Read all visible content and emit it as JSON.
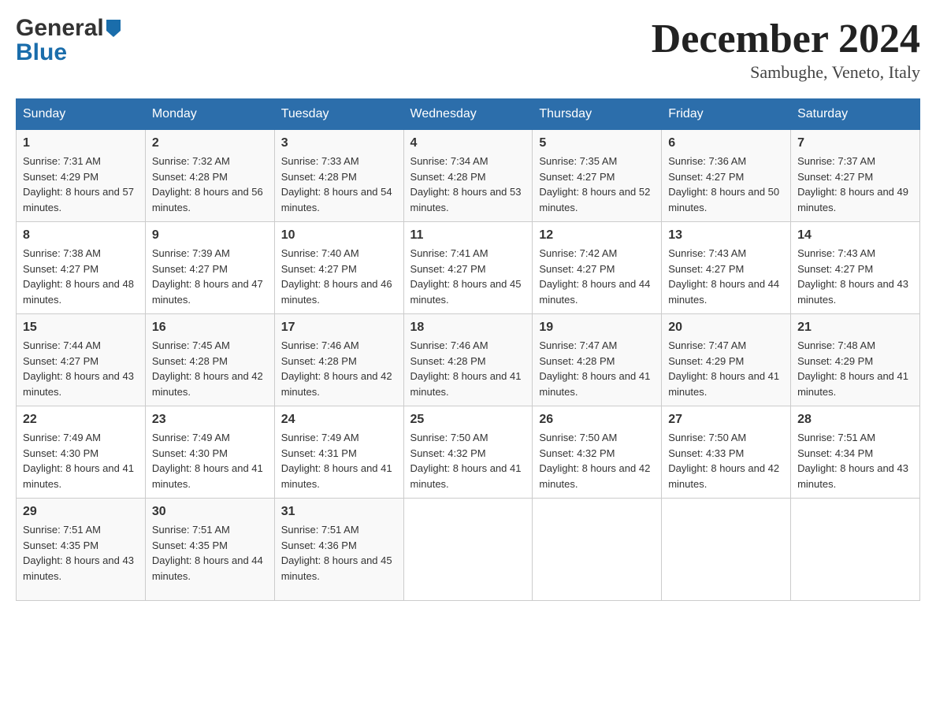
{
  "header": {
    "logo_general": "General",
    "logo_blue": "Blue",
    "month_title": "December 2024",
    "location": "Sambughe, Veneto, Italy"
  },
  "days_of_week": [
    "Sunday",
    "Monday",
    "Tuesday",
    "Wednesday",
    "Thursday",
    "Friday",
    "Saturday"
  ],
  "weeks": [
    [
      {
        "day": "1",
        "sunrise": "7:31 AM",
        "sunset": "4:29 PM",
        "daylight": "8 hours and 57 minutes."
      },
      {
        "day": "2",
        "sunrise": "7:32 AM",
        "sunset": "4:28 PM",
        "daylight": "8 hours and 56 minutes."
      },
      {
        "day": "3",
        "sunrise": "7:33 AM",
        "sunset": "4:28 PM",
        "daylight": "8 hours and 54 minutes."
      },
      {
        "day": "4",
        "sunrise": "7:34 AM",
        "sunset": "4:28 PM",
        "daylight": "8 hours and 53 minutes."
      },
      {
        "day": "5",
        "sunrise": "7:35 AM",
        "sunset": "4:27 PM",
        "daylight": "8 hours and 52 minutes."
      },
      {
        "day": "6",
        "sunrise": "7:36 AM",
        "sunset": "4:27 PM",
        "daylight": "8 hours and 50 minutes."
      },
      {
        "day": "7",
        "sunrise": "7:37 AM",
        "sunset": "4:27 PM",
        "daylight": "8 hours and 49 minutes."
      }
    ],
    [
      {
        "day": "8",
        "sunrise": "7:38 AM",
        "sunset": "4:27 PM",
        "daylight": "8 hours and 48 minutes."
      },
      {
        "day": "9",
        "sunrise": "7:39 AM",
        "sunset": "4:27 PM",
        "daylight": "8 hours and 47 minutes."
      },
      {
        "day": "10",
        "sunrise": "7:40 AM",
        "sunset": "4:27 PM",
        "daylight": "8 hours and 46 minutes."
      },
      {
        "day": "11",
        "sunrise": "7:41 AM",
        "sunset": "4:27 PM",
        "daylight": "8 hours and 45 minutes."
      },
      {
        "day": "12",
        "sunrise": "7:42 AM",
        "sunset": "4:27 PM",
        "daylight": "8 hours and 44 minutes."
      },
      {
        "day": "13",
        "sunrise": "7:43 AM",
        "sunset": "4:27 PM",
        "daylight": "8 hours and 44 minutes."
      },
      {
        "day": "14",
        "sunrise": "7:43 AM",
        "sunset": "4:27 PM",
        "daylight": "8 hours and 43 minutes."
      }
    ],
    [
      {
        "day": "15",
        "sunrise": "7:44 AM",
        "sunset": "4:27 PM",
        "daylight": "8 hours and 43 minutes."
      },
      {
        "day": "16",
        "sunrise": "7:45 AM",
        "sunset": "4:28 PM",
        "daylight": "8 hours and 42 minutes."
      },
      {
        "day": "17",
        "sunrise": "7:46 AM",
        "sunset": "4:28 PM",
        "daylight": "8 hours and 42 minutes."
      },
      {
        "day": "18",
        "sunrise": "7:46 AM",
        "sunset": "4:28 PM",
        "daylight": "8 hours and 41 minutes."
      },
      {
        "day": "19",
        "sunrise": "7:47 AM",
        "sunset": "4:28 PM",
        "daylight": "8 hours and 41 minutes."
      },
      {
        "day": "20",
        "sunrise": "7:47 AM",
        "sunset": "4:29 PM",
        "daylight": "8 hours and 41 minutes."
      },
      {
        "day": "21",
        "sunrise": "7:48 AM",
        "sunset": "4:29 PM",
        "daylight": "8 hours and 41 minutes."
      }
    ],
    [
      {
        "day": "22",
        "sunrise": "7:49 AM",
        "sunset": "4:30 PM",
        "daylight": "8 hours and 41 minutes."
      },
      {
        "day": "23",
        "sunrise": "7:49 AM",
        "sunset": "4:30 PM",
        "daylight": "8 hours and 41 minutes."
      },
      {
        "day": "24",
        "sunrise": "7:49 AM",
        "sunset": "4:31 PM",
        "daylight": "8 hours and 41 minutes."
      },
      {
        "day": "25",
        "sunrise": "7:50 AM",
        "sunset": "4:32 PM",
        "daylight": "8 hours and 41 minutes."
      },
      {
        "day": "26",
        "sunrise": "7:50 AM",
        "sunset": "4:32 PM",
        "daylight": "8 hours and 42 minutes."
      },
      {
        "day": "27",
        "sunrise": "7:50 AM",
        "sunset": "4:33 PM",
        "daylight": "8 hours and 42 minutes."
      },
      {
        "day": "28",
        "sunrise": "7:51 AM",
        "sunset": "4:34 PM",
        "daylight": "8 hours and 43 minutes."
      }
    ],
    [
      {
        "day": "29",
        "sunrise": "7:51 AM",
        "sunset": "4:35 PM",
        "daylight": "8 hours and 43 minutes."
      },
      {
        "day": "30",
        "sunrise": "7:51 AM",
        "sunset": "4:35 PM",
        "daylight": "8 hours and 44 minutes."
      },
      {
        "day": "31",
        "sunrise": "7:51 AM",
        "sunset": "4:36 PM",
        "daylight": "8 hours and 45 minutes."
      },
      null,
      null,
      null,
      null
    ]
  ]
}
